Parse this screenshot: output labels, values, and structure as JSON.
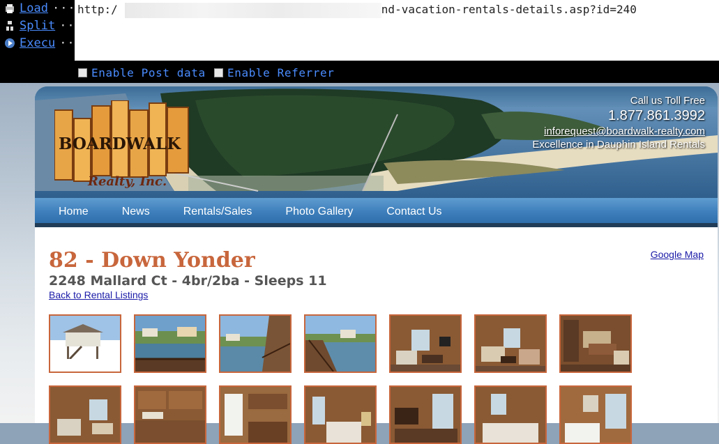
{
  "toolbar": {
    "items": [
      {
        "label": "Load",
        "icon": "load-url-icon"
      },
      {
        "label": "Split",
        "icon": "split-url-icon"
      },
      {
        "label": "Execu",
        "icon": "execute-icon"
      }
    ],
    "dots": "···",
    "url_prefix": "http:/",
    "url_suffix": "nd-vacation-rentals-details.asp?id=240",
    "enable_post_label": "Enable Post data",
    "enable_referrer_label": "Enable Referrer"
  },
  "header": {
    "logo_text": "BOARDWALK",
    "logo_sub": "Realty, Inc.",
    "call_label": "Call us Toll Free",
    "phone": "1.877.861.3992",
    "email": "inforequest@boardwalk-realty.com",
    "tagline": "Excellence in Dauphin Island Rentals",
    "nav": [
      "Home",
      "News",
      "Rentals/Sales",
      "Photo Gallery",
      "Contact Us"
    ]
  },
  "listing": {
    "title": "82 - Down Yonder",
    "subtitle": "2248 Mallard Ct - 4br/2ba - Sleeps 11",
    "back_link": "Back to Rental Listings",
    "map_link": "Google Map"
  },
  "photos": {
    "row1": [
      "exterior",
      "canal-view",
      "canal-view",
      "deck-view",
      "living-room",
      "living-room",
      "dining-kitchen"
    ],
    "row2": [
      "living-room",
      "kitchen",
      "kitchen",
      "bedroom",
      "bedroom",
      "bedroom",
      "bedroom"
    ]
  },
  "colors": {
    "accent": "#c8663c",
    "nav_blue": "#3e7fbc",
    "link": "#1a1aa8",
    "toolbar_text": "#4a8cff"
  }
}
